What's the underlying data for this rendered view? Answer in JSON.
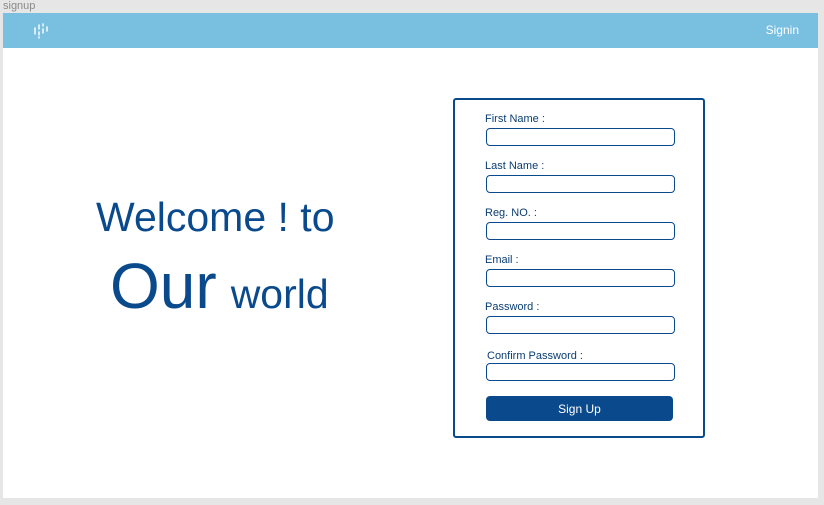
{
  "frame": {
    "label": "signup"
  },
  "navbar": {
    "logo_icon": "dotted-mark-icon",
    "signin_label": "Signin"
  },
  "hero": {
    "line1": "Welcome ! to",
    "line2_big": "Our",
    "line2_small": "world"
  },
  "form": {
    "fields": [
      {
        "label": "First Name :",
        "value": ""
      },
      {
        "label": "Last Name :",
        "value": ""
      },
      {
        "label": "Reg. NO. :",
        "value": ""
      },
      {
        "label": "Email :",
        "value": ""
      },
      {
        "label": "Password :",
        "value": ""
      },
      {
        "label": "Confirm Password :",
        "value": ""
      }
    ],
    "submit_label": "Sign Up"
  },
  "colors": {
    "navbar": "#78bfe0",
    "primary": "#0a4a8c",
    "background": "#ffffff",
    "canvas": "#e6e6e6"
  }
}
